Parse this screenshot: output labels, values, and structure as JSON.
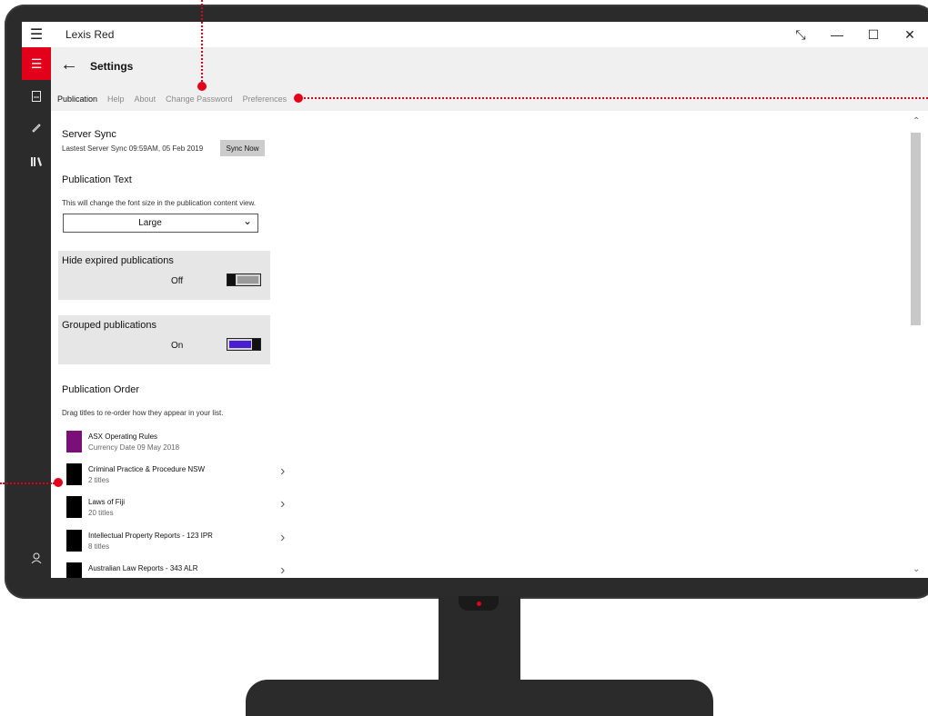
{
  "window": {
    "app_title": "Lexis Red",
    "controls": [
      "expand-icon",
      "minimize-icon",
      "maximize-icon",
      "close-icon"
    ]
  },
  "colors": {
    "accent": "#e3001b",
    "rail": "#2b2b2b",
    "header_bg": "#f0f0f0",
    "toggle_on": "#4b1fd0"
  },
  "rail": {
    "items": [
      {
        "icon": "book-icon"
      },
      {
        "icon": "pencil-icon"
      },
      {
        "icon": "library-icon"
      },
      {
        "icon": "user-icon"
      },
      {
        "icon": "gear-icon"
      }
    ]
  },
  "header": {
    "title": "Settings"
  },
  "tabs": [
    {
      "label": "Publication",
      "active": true
    },
    {
      "label": "Help",
      "active": false
    },
    {
      "label": "About",
      "active": false
    },
    {
      "label": "Change Password",
      "active": false
    },
    {
      "label": "Preferences",
      "active": false
    }
  ],
  "server_sync": {
    "title": "Server Sync",
    "last_sync": "Lastest Server Sync 09:59AM, 05 Feb 2019",
    "button_label": "Sync Now"
  },
  "publication_text": {
    "title": "Publication Text",
    "description": "This will change the font size in the publication content view.",
    "selected_value": "Large"
  },
  "hide_expired": {
    "label": "Hide expired publications",
    "state_label": "Off",
    "on": false
  },
  "grouped": {
    "label": "Grouped publications",
    "state_label": "On",
    "on": true
  },
  "publication_order": {
    "title": "Publication Order",
    "description": "Drag titles to re-order how they appear in your list.",
    "items": [
      {
        "name": "ASX Operating Rules",
        "sub": "Currency Date  09 May 2018",
        "color": "#7a0f7a",
        "has_chevron": false
      },
      {
        "name": "Criminal Practice & Procedure NSW",
        "sub": "2  titles",
        "color": "#000000",
        "has_chevron": true
      },
      {
        "name": "Laws of Fiji",
        "sub": "20  titles",
        "color": "#000000",
        "has_chevron": true
      },
      {
        "name": "Intellectual Property Reports - 123 IPR",
        "sub": "8  titles",
        "color": "#000000",
        "has_chevron": true
      },
      {
        "name": "Australian Law Reports - 343 ALR",
        "sub": "",
        "color": "#000000",
        "has_chevron": true
      }
    ]
  }
}
